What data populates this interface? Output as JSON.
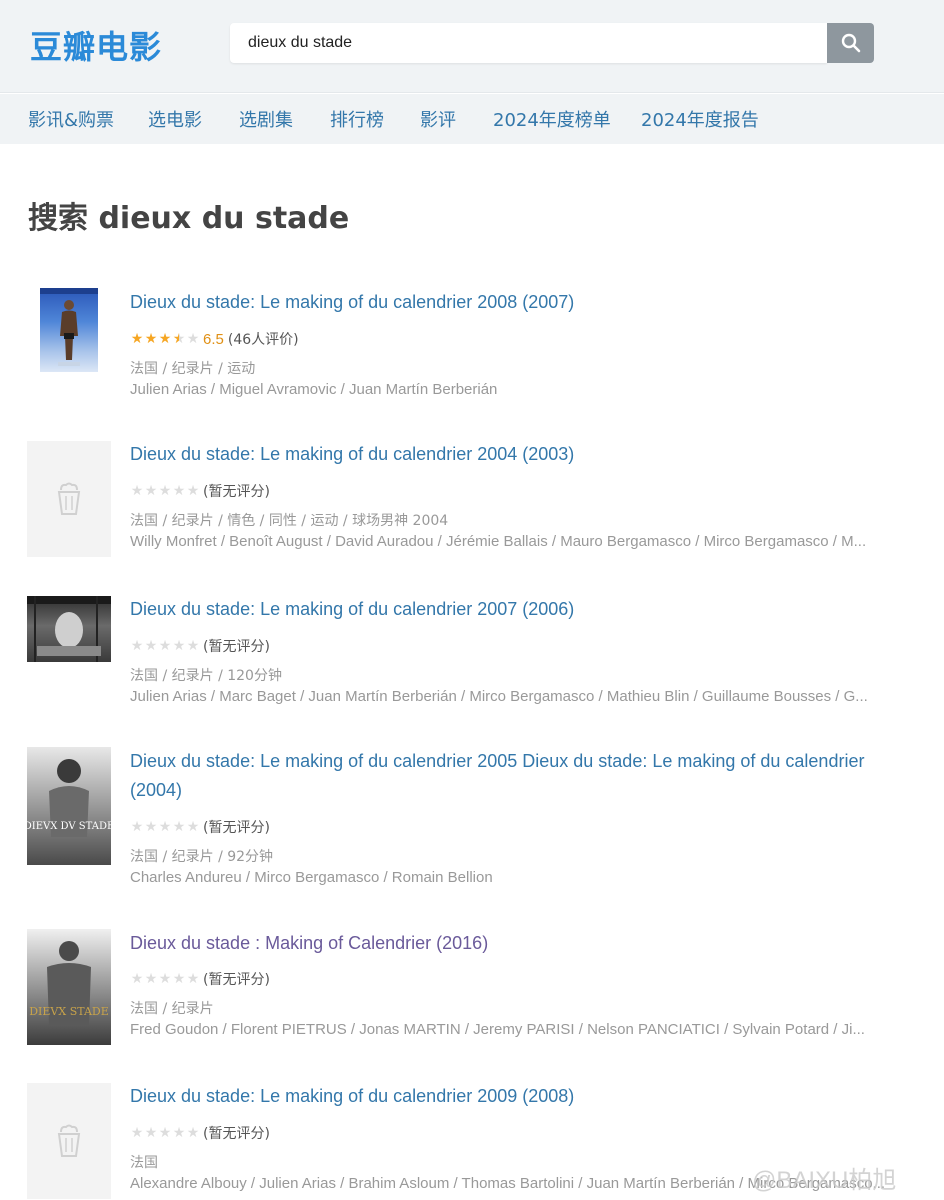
{
  "header": {
    "logo": "豆瓣电影",
    "search_value": "dieux du stade",
    "search_icon": "search-icon"
  },
  "nav": [
    {
      "label": "影讯&购票"
    },
    {
      "label": "选电影"
    },
    {
      "label": "选剧集"
    },
    {
      "label": "排行榜"
    },
    {
      "label": "影评"
    },
    {
      "label": "2024年度榜单"
    },
    {
      "label": "2024年度报告"
    }
  ],
  "page_title": "搜索 dieux du stade",
  "results": [
    {
      "title": "Dieux du stade: Le making of du calendrier 2008 (2007)",
      "rating": "6.5",
      "rating_stars": 3.5,
      "rating_count": "(46人评价)",
      "meta": "法国 / 纪录片 / 运动",
      "cast": "Julien Arias / Miguel Avramovic / Juan Martín Berberián"
    },
    {
      "title": "Dieux du stade: Le making of du calendrier 2004 (2003)",
      "rating_count": "(暂无评分)",
      "meta": "法国 / 纪录片 / 情色 / 同性 / 运动 / 球场男神 2004",
      "cast": "Willy Monfret / Benoît August / David Auradou / Jérémie Ballais / Mauro Bergamasco / Mirco Bergamasco / M..."
    },
    {
      "title": "Dieux du stade: Le making of du calendrier 2007 (2006)",
      "rating_count": "(暂无评分)",
      "meta": "法国 / 纪录片 / 120分钟",
      "cast": "Julien Arias / Marc Baget / Juan Martín Berberián / Mirco Bergamasco / Mathieu Blin / Guillaume Bousses / G..."
    },
    {
      "title": "Dieux du stade: Le making of du calendrier 2005 Dieux du stade: Le making of du calendrier (2004)",
      "rating_count": "(暂无评分)",
      "meta": "法国 / 纪录片 / 92分钟",
      "cast": "Charles Andureu / Mirco Bergamasco / Romain Bellion",
      "poster_text": "DIEVX DV STADE"
    },
    {
      "title": "Dieux du stade : Making of Calendrier (2016)",
      "rating_count": "(暂无评分)",
      "meta": "法国 / 纪录片",
      "cast": "Fred Goudon / Florent PIETRUS / Jonas MARTIN / Jeremy PARISI / Nelson PANCIATICI / Sylvain Potard / Ji...",
      "poster_text": "DIEVX STADE"
    },
    {
      "title": "Dieux du stade: Le making of du calendrier 2009 (2008)",
      "rating_count": "(暂无评分)",
      "meta": "法国",
      "cast": "Alexandre Albouy / Julien Arias / Brahim Asloum / Thomas Bartolini / Juan Martín Berberián / Mirco Bergamasco..."
    }
  ],
  "watermark": "@BAIXU柏旭",
  "colors": {
    "brand": "#2b8ad8",
    "link": "#3377aa",
    "star": "#f6a623",
    "header_bg": "#f0f3f5"
  }
}
